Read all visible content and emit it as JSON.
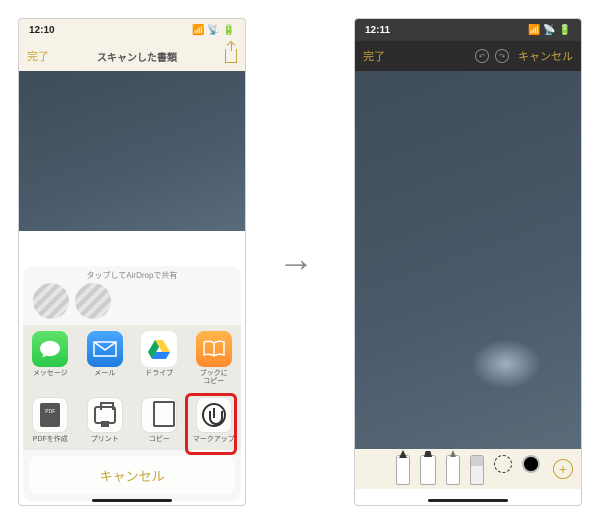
{
  "left": {
    "status": {
      "time": "12:10",
      "indicators": "📶 📡 🔋"
    },
    "nav": {
      "done": "完了",
      "title": "スキャンした書類"
    },
    "sheet": {
      "airdrop_hint": "タップしてAirDropで共有",
      "apps": [
        {
          "key": "messages",
          "label": "メッセージ"
        },
        {
          "key": "mail",
          "label": "メール"
        },
        {
          "key": "drive",
          "label": "ドライブ"
        },
        {
          "key": "books",
          "label": "ブックに\nコピー"
        }
      ],
      "actions": [
        {
          "key": "pdf",
          "label": "PDFを作成"
        },
        {
          "key": "print",
          "label": "プリント"
        },
        {
          "key": "copy",
          "label": "コピー"
        },
        {
          "key": "markup",
          "label": "マークアップ"
        }
      ],
      "cancel": "キャンセル"
    }
  },
  "right": {
    "status": {
      "time": "12:11",
      "indicators": "📶 📡 🔋"
    },
    "nav": {
      "done": "完了",
      "cancel": "キャンセル"
    },
    "tools": [
      "pen",
      "marker",
      "pencil",
      "eraser",
      "lasso",
      "color"
    ]
  },
  "arrow": "→"
}
